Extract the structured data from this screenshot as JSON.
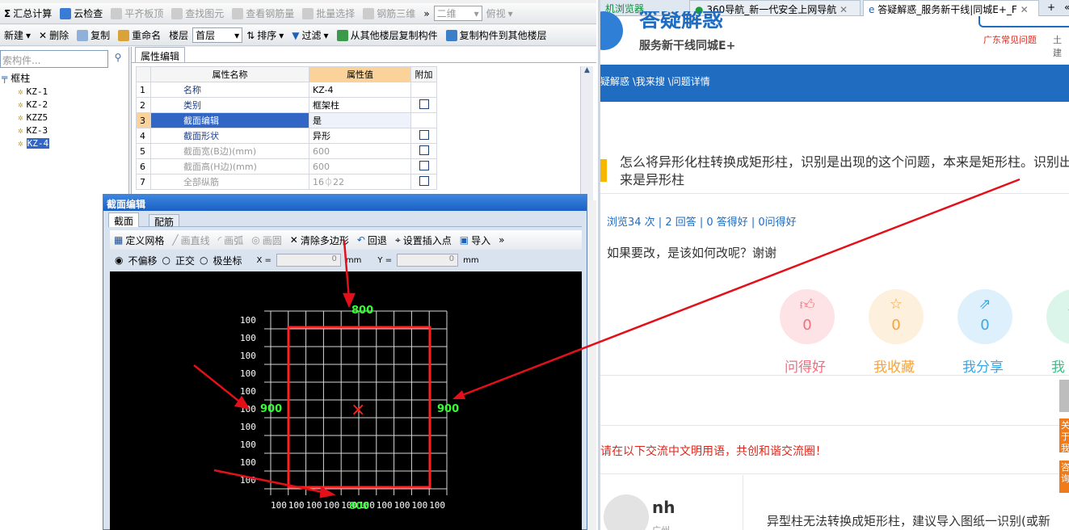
{
  "toolbar1": {
    "items": [
      "汇总计算",
      "云检查",
      "平齐板顶",
      "查找图元",
      "查看钢筋量",
      "批量选择",
      "钢筋三维"
    ],
    "view_mode": "二维",
    "view_angle": "俯视",
    "more": "»"
  },
  "toolbar2": {
    "new": "新建",
    "delete": "删除",
    "copy": "复制",
    "rename": "重命名",
    "floor_label": "楼层",
    "floor_value": "首层",
    "sort": "排序",
    "filter": "过滤",
    "copy_from": "从其他楼层复制构件",
    "copy_to": "复制构件到其他楼层"
  },
  "tree": {
    "search_placeholder": "索构件...",
    "root": "框柱",
    "items": [
      "KZ-1",
      "KZ-2",
      "KZZ5",
      "KZ-3",
      "KZ-4"
    ],
    "selected": "KZ-4"
  },
  "props": {
    "tab": "属性编辑",
    "headers": [
      "属性名称",
      "属性值",
      "附加"
    ],
    "rows": [
      {
        "n": "1",
        "name": "名称",
        "value": "KZ-4"
      },
      {
        "n": "2",
        "name": "类别",
        "value": "框架柱"
      },
      {
        "n": "3",
        "name": "截面编辑",
        "value": "是"
      },
      {
        "n": "4",
        "name": "截面形状",
        "value": "异形"
      },
      {
        "n": "5",
        "name": "截面宽(B边)(mm)",
        "value": "600"
      },
      {
        "n": "6",
        "name": "截面高(H边)(mm)",
        "value": "600"
      },
      {
        "n": "7",
        "name": "全部纵筋",
        "value": "16⏀22"
      }
    ]
  },
  "dialog": {
    "title": "截面编辑",
    "tabs": [
      "截面",
      "配筋"
    ],
    "tools": [
      "定义网格",
      "画直线",
      "画弧",
      "画圆",
      "清除多边形",
      "回退",
      "设置插入点",
      "导入"
    ],
    "snap": [
      "不偏移",
      "正交",
      "极坐标"
    ],
    "x_label": "X =",
    "x_value": "0",
    "y_label": "Y =",
    "y_value": "0",
    "unit": "mm",
    "top_dim": "800",
    "left_dim": "900",
    "right_dim": "900",
    "bottom_dim": "800",
    "grid_label": "100"
  },
  "browser": {
    "tabs": [
      "机浏览器",
      "360导航_新一代安全上网导航",
      "答疑解惑_服务新干线|同城E+_F"
    ],
    "new_tab": "+",
    "menu": "«"
  },
  "site": {
    "logo_title": "答疑解惑",
    "logo_sub": "服务新干线同城E+",
    "links": [
      "广东常见问题",
      "土建"
    ],
    "breadcrumb": "疑解惑 \\我来搜 \\问题详情",
    "question": "怎么将异形化柱转换成矩形柱，识别是出现的这个问题，本来是矩形柱。识别出来是异形柱",
    "stats": "浏览34 次 | 2 回答 | 0 答得好 | 0问得好",
    "ask": "如果要改，是该如何改呢？谢谢",
    "actions": [
      {
        "label": "问得好",
        "count": "0"
      },
      {
        "label": "我收藏",
        "count": "0"
      },
      {
        "label": "我分享",
        "count": "0"
      },
      {
        "label": "我"
      }
    ],
    "notice": "请在以下交流中文明用语，共创和谐交流圈！",
    "user": "nh",
    "user_loc": "广州",
    "answer": "异型柱无法转换成矩形柱，建议导入图纸一识别(或新",
    "side_btns": [
      "关于我们",
      "咨询"
    ],
    "colors": {
      "brand": "#1f6cc1",
      "pink": "#f26d7d",
      "orange": "#f7a43c",
      "blue": "#3aa7e4",
      "green": "#3bbf8a",
      "accent": "#e0261b"
    }
  }
}
